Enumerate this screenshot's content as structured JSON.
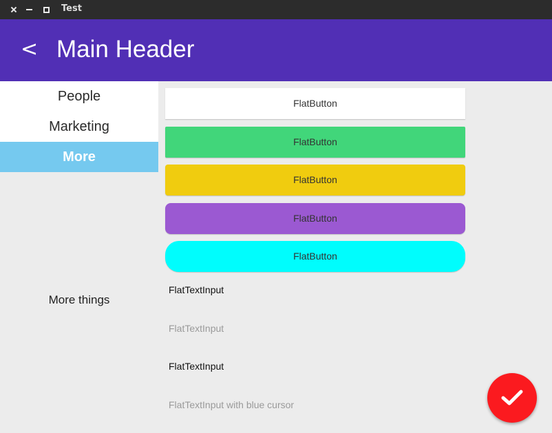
{
  "window": {
    "title": "Test"
  },
  "header": {
    "back_label": "<",
    "title": "Main Header",
    "color": "#512fb5"
  },
  "sidebar": {
    "items": [
      {
        "label": "People",
        "selected": false
      },
      {
        "label": "Marketing",
        "selected": false
      },
      {
        "label": "More",
        "selected": true
      }
    ],
    "selected_color": "#75c9ef",
    "footer_text": "More things"
  },
  "buttons": [
    {
      "label": "FlatButton",
      "color": "#ffffff"
    },
    {
      "label": "FlatButton",
      "color": "#41d67a"
    },
    {
      "label": "FlatButton",
      "color": "#f0cc0f"
    },
    {
      "label": "FlatButton",
      "color": "#9b59d2"
    },
    {
      "label": "FlatButton",
      "color": "#00fdfd"
    }
  ],
  "inputs": [
    {
      "value": "FlatTextInput",
      "placeholder": ""
    },
    {
      "value": "",
      "placeholder": "FlatTextInput"
    },
    {
      "value": "FlatTextInput",
      "placeholder": ""
    },
    {
      "value": "",
      "placeholder": "FlatTextInput with blue cursor"
    }
  ],
  "fab": {
    "icon": "checkmark-icon",
    "color": "#fb1a1f"
  }
}
